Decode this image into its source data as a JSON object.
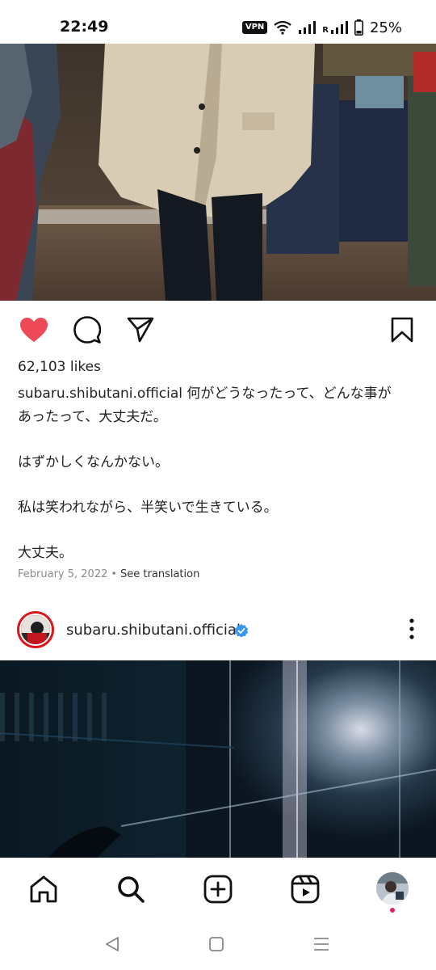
{
  "status_bar": {
    "time": "22:49",
    "vpn_label": "VPN",
    "roaming_label": "R",
    "battery": "25%"
  },
  "post": {
    "likes": "62,103 likes",
    "username": "subaru.shibutani.official",
    "caption_line1": "何がどうなったって、どんな事が",
    "caption_line2": "あったって、大丈夫だ。",
    "caption_para2": "はずかしくなんかない。",
    "caption_para3": "私は笑われながら、半笑いで生きている。",
    "caption_para4": "大丈夫。",
    "date": "February 5, 2022",
    "separator": "•",
    "translate_label": "See translation"
  },
  "next_post": {
    "username": "subaru.shibutani.official"
  },
  "icons": {
    "like": "heart-icon",
    "comment": "comment-icon",
    "share": "paper-plane-icon",
    "save": "bookmark-icon",
    "verified": "verified-badge-icon",
    "more": "more-vertical-icon",
    "home": "home-icon",
    "search": "search-icon",
    "create": "plus-square-icon",
    "reels": "reels-icon",
    "back": "back-triangle-icon",
    "recent": "square-icon",
    "menu": "menu-lines-icon"
  },
  "colors": {
    "like_red": "#ed4956",
    "verified_blue": "#3797f0",
    "notification_dot": "#e0245e"
  }
}
